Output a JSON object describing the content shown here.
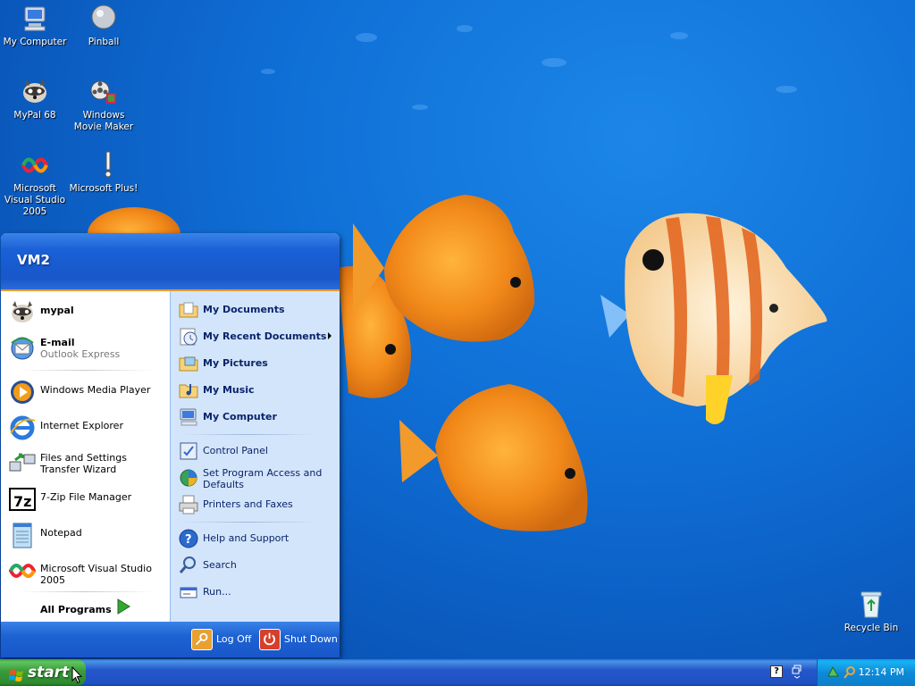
{
  "desktop": {
    "icons": [
      {
        "label": "My Computer",
        "icon": "computer-icon"
      },
      {
        "label": "Pinball",
        "icon": "pinball-icon"
      },
      {
        "label": "MyPal 68",
        "icon": "raccoon-icon"
      },
      {
        "label": "Windows Movie Maker",
        "icon": "film-icon"
      },
      {
        "label": "Microsoft Visual Studio 2005",
        "icon": "visual-studio-icon"
      },
      {
        "label": "Microsoft Plus!",
        "icon": "plus-icon"
      },
      {
        "label": "Recycle Bin",
        "icon": "recycle-bin-icon"
      }
    ]
  },
  "start_menu": {
    "user": "VM2",
    "pinned": [
      {
        "label": "mypal",
        "icon": "raccoon-icon"
      },
      {
        "label": "E-mail",
        "sub": "Outlook Express",
        "icon": "email-icon"
      }
    ],
    "recent": [
      {
        "label": "Windows Media Player",
        "icon": "media-player-icon"
      },
      {
        "label": "Internet Explorer",
        "icon": "internet-explorer-icon"
      },
      {
        "label": "Files and Settings Transfer Wizard",
        "icon": "transfer-wizard-icon"
      },
      {
        "label": "7-Zip File Manager",
        "icon": "7zip-icon"
      },
      {
        "label": "Notepad",
        "icon": "notepad-icon"
      },
      {
        "label": "Microsoft Visual Studio 2005",
        "icon": "visual-studio-icon"
      }
    ],
    "all_programs": "All Programs",
    "places": [
      {
        "label": "My Documents",
        "icon": "folder-documents-icon"
      },
      {
        "label": "My Recent Documents",
        "icon": "recent-documents-icon"
      },
      {
        "label": "My Pictures",
        "icon": "folder-pictures-icon"
      },
      {
        "label": "My Music",
        "icon": "folder-music-icon"
      },
      {
        "label": "My Computer",
        "icon": "computer-icon"
      }
    ],
    "settings": [
      {
        "label": "Control Panel",
        "icon": "control-panel-icon"
      },
      {
        "label": "Set Program Access and Defaults",
        "icon": "program-defaults-icon"
      },
      {
        "label": "Printers and Faxes",
        "icon": "printer-icon"
      }
    ],
    "tools": [
      {
        "label": "Help and Support",
        "icon": "help-icon"
      },
      {
        "label": "Search",
        "icon": "search-icon"
      },
      {
        "label": "Run...",
        "icon": "run-icon"
      }
    ],
    "footer": {
      "log_off": "Log Off",
      "shut_down": "Shut Down"
    }
  },
  "taskbar": {
    "start_label": "start",
    "clock": "12:14 PM",
    "help_glyph": "?"
  },
  "colors": {
    "desktop_bg": "#0f6fd6",
    "taskbar_blue": "#2457ca",
    "start_green": "#3a9a3a",
    "menu_header": "#1a60d6",
    "menu_right_pane": "#d3e5fa",
    "accent_orange": "#e89a30"
  }
}
